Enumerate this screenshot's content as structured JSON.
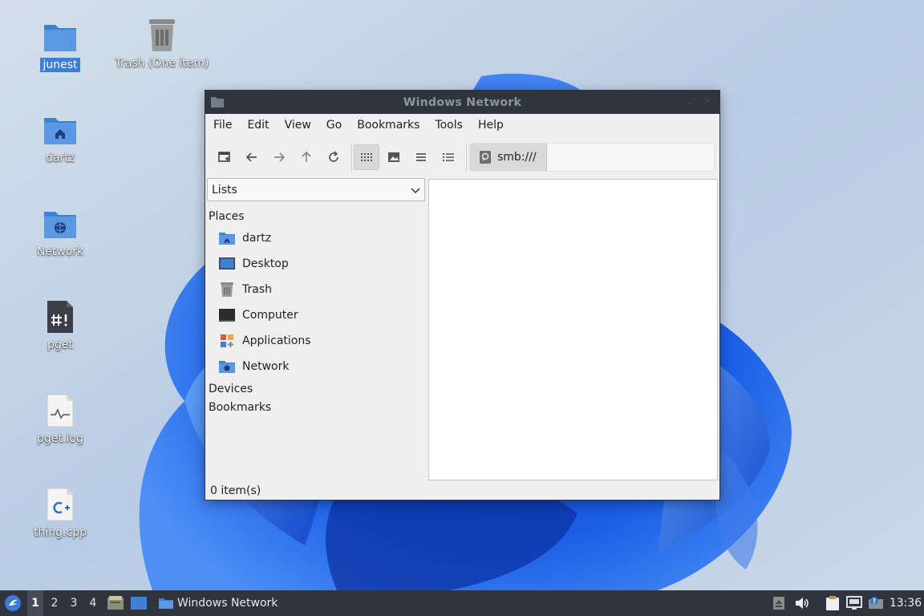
{
  "desktop": {
    "icons": [
      {
        "label": "junest",
        "icon": "folder-icon",
        "selected": true
      },
      {
        "label": "Trash (One item)",
        "icon": "trash-icon",
        "selected": false
      },
      {
        "label": "dartz",
        "icon": "home-folder-icon",
        "selected": false
      },
      {
        "label": "Network",
        "icon": "network-folder-icon",
        "selected": false
      },
      {
        "label": "pget",
        "icon": "script-file-icon",
        "selected": false
      },
      {
        "label": "pget.log",
        "icon": "log-file-icon",
        "selected": false
      },
      {
        "label": "thing.cpp",
        "icon": "cpp-file-icon",
        "selected": false
      }
    ]
  },
  "window": {
    "title": "Windows Network",
    "menu": [
      "File",
      "Edit",
      "View",
      "Go",
      "Bookmarks",
      "Tools",
      "Help"
    ],
    "toolbar": {
      "buttons": [
        "new-tab-icon",
        "back-icon",
        "forward-icon",
        "up-icon",
        "reload-icon",
        "icon-view-icon",
        "thumbnail-view-icon",
        "compact-view-icon",
        "detailed-list-icon"
      ],
      "active_view": "icon-view-icon"
    },
    "location": "smb:///",
    "side_pane": {
      "selector": "Lists",
      "sections": {
        "places": "Places",
        "devices": "Devices",
        "bookmarks": "Bookmarks"
      },
      "places": [
        {
          "label": "dartz",
          "icon": "home-folder-icon"
        },
        {
          "label": "Desktop",
          "icon": "desktop-icon"
        },
        {
          "label": "Trash",
          "icon": "trash-icon"
        },
        {
          "label": "Computer",
          "icon": "computer-icon"
        },
        {
          "label": "Applications",
          "icon": "applications-icon"
        },
        {
          "label": "Network",
          "icon": "network-folder-icon"
        }
      ]
    },
    "status": "0 item(s)"
  },
  "taskbar": {
    "workspaces": [
      "1",
      "2",
      "3",
      "4"
    ],
    "current_workspace": "1",
    "task": "Windows Network",
    "clock": "13:36",
    "tray": [
      "eject-icon",
      "volume-icon",
      "clipboard-icon",
      "network-tray-icon",
      "update-notifier-icon"
    ]
  },
  "colors": {
    "panel": "#2f343f",
    "accent": "#3d7fd6",
    "folder": "#4a88d8",
    "window_bg": "#efefef"
  }
}
